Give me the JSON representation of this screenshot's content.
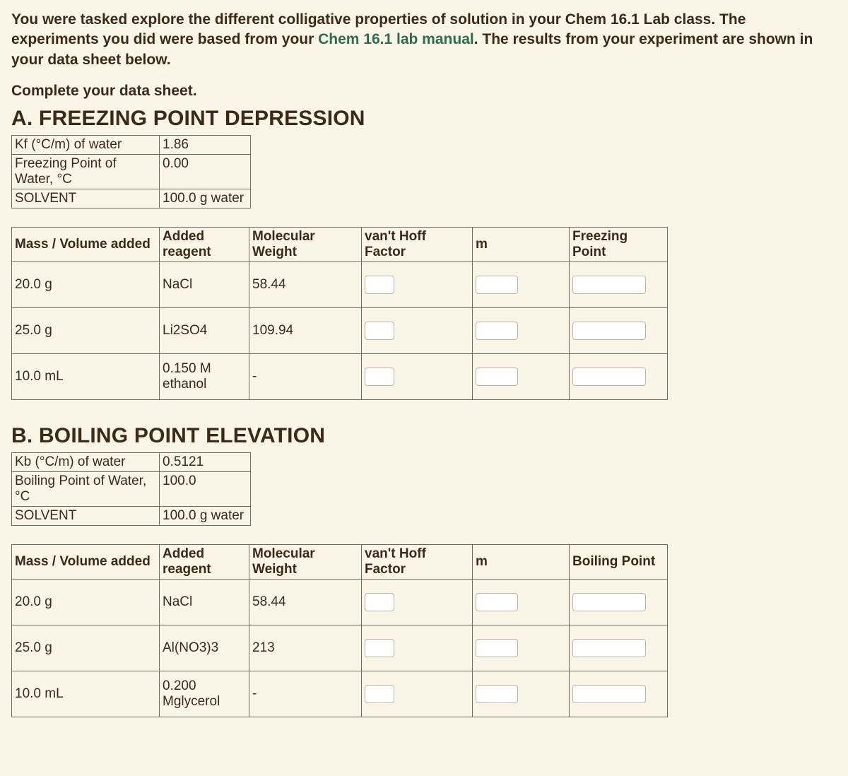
{
  "intro": {
    "part1": "You were tasked explore the different colligative properties of solution in your Chem 16.1 Lab class. The experiments you did were based from your ",
    "link_text": "Chem 16.1 lab manual",
    "part2": ". The results from your experiment are shown in your data sheet below."
  },
  "prompt": "Complete your data sheet.",
  "sectionA": {
    "title": "A. FREEZING POINT DEPRESSION",
    "info": {
      "row1_label": "Kf (°C/m) of water",
      "row1_value": "1.86",
      "row2_label": "Freezing Point of Water, °C",
      "row2_value": "0.00",
      "row3_label": "SOLVENT",
      "row3_value": "100.0 g water"
    },
    "headers": {
      "mass": "Mass / Volume added",
      "reagent": "Added reagent",
      "mw": "Molecular Weight",
      "vhf": "van't Hoff Factor",
      "m": "m",
      "result": "Freezing Point"
    },
    "rows": [
      {
        "mass": "20.0 g",
        "reagent": "NaCl",
        "mw": "58.44"
      },
      {
        "mass": "25.0 g",
        "reagent": "Li2SO4",
        "mw": "109.94"
      },
      {
        "mass": "10.0 mL",
        "reagent": "0.150 M ethanol",
        "mw": "-"
      }
    ]
  },
  "sectionB": {
    "title": "B. BOILING POINT ELEVATION",
    "info": {
      "row1_label": "Kb (°C/m) of water",
      "row1_value": "0.5121",
      "row2_label": "Boiling Point of Water, °C",
      "row2_value": "100.0",
      "row3_label": "SOLVENT",
      "row3_value": "100.0 g water"
    },
    "headers": {
      "mass": "Mass / Volume added",
      "reagent": "Added reagent",
      "mw": "Molecular Weight",
      "vhf": "van't Hoff Factor",
      "m": "m",
      "result": "Boiling Point"
    },
    "rows": [
      {
        "mass": "20.0 g",
        "reagent": "NaCl",
        "mw": "58.44"
      },
      {
        "mass": "25.0 g",
        "reagent": "Al(NO3)3",
        "mw": "213"
      },
      {
        "mass": "10.0 mL",
        "reagent": "0.200 Mglycerol",
        "mw": "-"
      }
    ]
  }
}
